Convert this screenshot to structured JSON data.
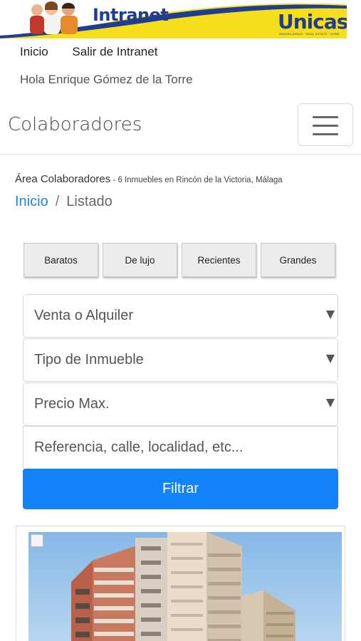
{
  "banner": {
    "title": "Intranet",
    "brand": "Unicasa",
    "tagline": "INMOBILIARIAS · REAL ESTATE · HOME",
    "colors": {
      "yellow": "#f6df1a",
      "navy": "#1f3e93"
    }
  },
  "top_links": {
    "home": "Inicio",
    "logout": "Salir de Intranet"
  },
  "greeting": "Hola Enrique Gómez de la Torre",
  "navbar": {
    "brand": "Colaboradores",
    "menu_icon": "hamburger-icon"
  },
  "section": {
    "title": "Área Colaboradores",
    "subtitle": " - 6 Inmuebles en Rincón de la Victoria, Málaga"
  },
  "breadcrumb": {
    "home": "Inicio",
    "separator": "/",
    "current": "Listado"
  },
  "filter_buttons": [
    "Baratos",
    "De lujo",
    "Recientes",
    "Grandes"
  ],
  "form": {
    "operation": "Venta o Alquiler",
    "property_type": "Tipo de Inmueble",
    "max_price": "Precio Max.",
    "search_placeholder": "Referencia, calle, localidad, etc...",
    "submit": "Filtrar"
  },
  "accent_color": "#1282f9"
}
